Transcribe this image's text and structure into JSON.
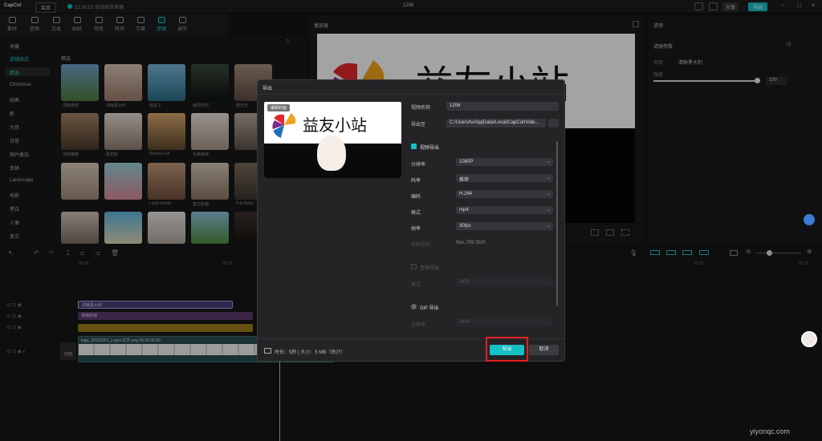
{
  "app": {
    "logo": "CapCut",
    "menu_label": "菜单",
    "autosave_text": "22:26:53 自动保存草稿",
    "project_title": "1206",
    "share_label": "分享",
    "export_label": "导出"
  },
  "toolbar": {
    "tools": [
      {
        "label": "素材",
        "icon": "media-icon"
      },
      {
        "label": "音频",
        "icon": "audio-icon"
      },
      {
        "label": "文本",
        "icon": "text-icon"
      },
      {
        "label": "贴纸",
        "icon": "sticker-icon"
      },
      {
        "label": "特效",
        "icon": "effects-icon"
      },
      {
        "label": "转场",
        "icon": "transition-icon"
      },
      {
        "label": "字幕",
        "icon": "caption-icon"
      },
      {
        "label": "滤镜",
        "icon": "filter-icon"
      },
      {
        "label": "调节",
        "icon": "adjust-icon"
      }
    ]
  },
  "sidebar": {
    "items": [
      "收藏",
      "滤镜商店",
      "精选",
      "Christmas",
      "经典",
      "新",
      "大热",
      "日常",
      "图片叠加",
      "变暗",
      "Landscape",
      "电影",
      "黑白",
      "人像",
      "复古"
    ],
    "selected_index": 2
  },
  "library": {
    "section_title": "精选",
    "sort_label": "Tr",
    "thumbs": [
      "清晰通透",
      "清晰黑大利",
      "嘿丝 2",
      "暗调自然",
      "暗光光",
      "清晰慵懒",
      "蒙奶肌",
      "Woody Fall",
      "毛茸朗读",
      "",
      "",
      "",
      "",
      "",
      "",
      "",
      "",
      "Lucid Nordic",
      "复古影画",
      "Pub Britia"
    ]
  },
  "player": {
    "title": "播放器"
  },
  "right_panel": {
    "title": "滤镜",
    "section": "滤镜参数",
    "name_label": "名称",
    "name_value": "清晰黑大利",
    "intensity_label": "强度",
    "intensity_value": "100",
    "intensity": 1.0
  },
  "timeline": {
    "ticks": [
      "00:00",
      "00:03",
      "00:06",
      "00:09",
      "00:12"
    ],
    "clips": {
      "filter_clip": "清晰黑大利",
      "effect_clip": "清晰影帧",
      "image_clip": "logo_20221001_Logo+文字.png  00:00:05:00"
    },
    "cover_label": "封面"
  },
  "dialog": {
    "title": "导出",
    "edit_cover_label": "编辑封面",
    "preview_text": "益友小站",
    "fields": {
      "name_label": "视频名称",
      "name_value": "1206",
      "path_label": "导出至",
      "path_value": "C:/Users/lu/AppData/Local/CapCut/Vide..."
    },
    "video_export": {
      "label": "视频导出",
      "checked": true,
      "resolution_label": "分辨率",
      "resolution_value": "1080P",
      "bitrate_label": "码率",
      "bitrate_value": "推荐",
      "codec_label": "编码",
      "codec_value": "H.264",
      "format_label": "格式",
      "format_value": "mp4",
      "fps_label": "帧率",
      "fps_value": "30fps",
      "color_label": "色彩空间",
      "color_value": "Rec.709 SDR"
    },
    "audio_export": {
      "label": "音频导出",
      "format_label": "格式",
      "format_value": "MP3"
    },
    "gif_export": {
      "label": "GIF 导出",
      "resolution_label": "分辨率",
      "resolution_value": "240P"
    },
    "footer": {
      "info": "时长：5秒 | 大小：5 MB（估计）",
      "export_button": "导出",
      "cancel_button": "取消"
    }
  },
  "watermark": "yiyonqc.com",
  "colors": {
    "accent": "#17bfc6",
    "highlight_box": "#e02020",
    "dialog_bg": "#242427"
  }
}
